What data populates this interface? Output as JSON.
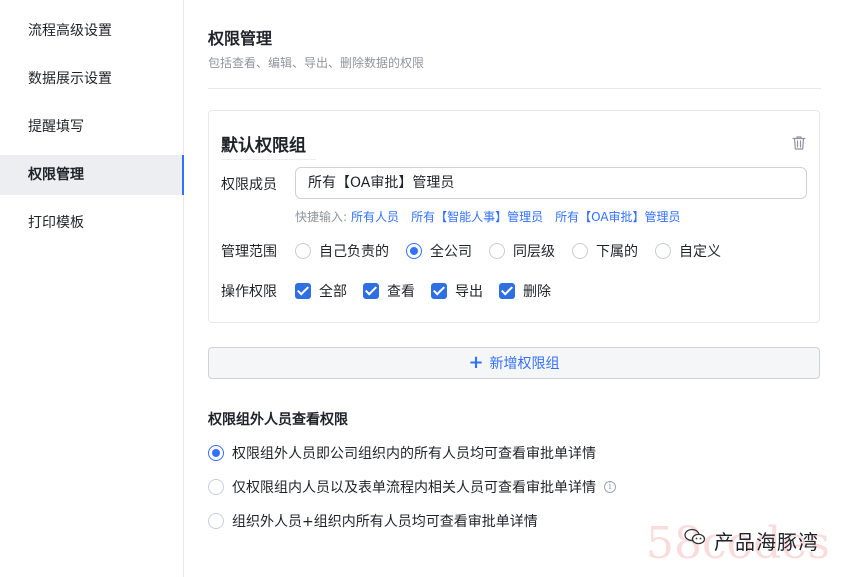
{
  "sidebar": {
    "items": [
      {
        "label": "流程高级设置"
      },
      {
        "label": "数据展示设置"
      },
      {
        "label": "提醒填写"
      },
      {
        "label": "权限管理"
      },
      {
        "label": "打印模板"
      }
    ],
    "active_index": 3
  },
  "section": {
    "title": "权限管理",
    "desc": "包括查看、编辑、导出、删除数据的权限"
  },
  "group": {
    "title": "默认权限组",
    "member_label": "权限成员",
    "member_value": "所有【OA审批】管理员",
    "quick_label": "快捷输入:",
    "quick_links": [
      "所有人员",
      "所有【智能人事】管理员",
      "所有【OA审批】管理员"
    ],
    "scope_label": "管理范围",
    "scope_options": [
      "自己负责的",
      "全公司",
      "同层级",
      "下属的",
      "自定义"
    ],
    "scope_selected": "全公司",
    "ops_label": "操作权限",
    "ops_options": [
      "全部",
      "查看",
      "导出",
      "删除"
    ],
    "ops_checked": [
      "全部",
      "查看",
      "导出",
      "删除"
    ]
  },
  "add_group_button": "新增权限组",
  "outside": {
    "title": "权限组外人员查看权限",
    "options": [
      "权限组外人员即公司组织内的所有人员均可查看审批单详情",
      "仅权限组内人员以及表单流程内相关人员可查看审批单详情",
      "组织外人员+组织内所有人员均可查看审批单详情"
    ],
    "selected_index": 0
  },
  "watermark": {
    "text": "产品海豚湾",
    "big": "58codes"
  },
  "colors": {
    "accent": "#3370ff",
    "checkbox": "#2f6fe4",
    "active_bg": "#eceef1"
  }
}
